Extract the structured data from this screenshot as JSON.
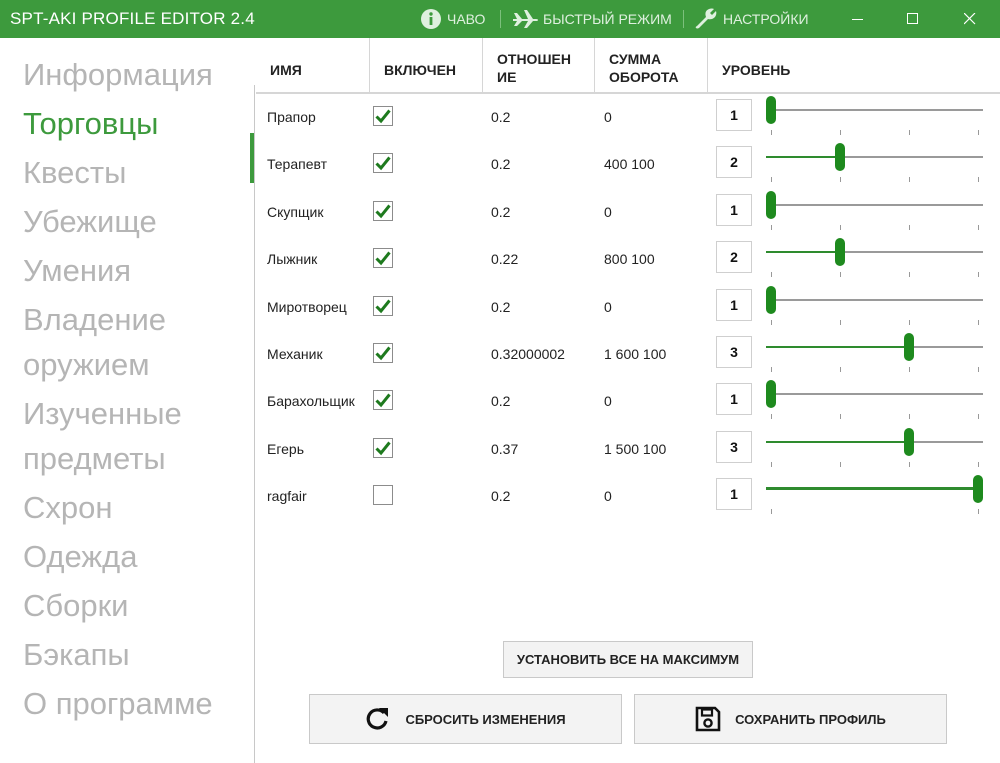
{
  "app": {
    "title": "SPT-AKI PROFILE EDITOR  2.4"
  },
  "titlebar": {
    "faq": "ЧАВО",
    "fast_mode": "БЫСТРЫЙ РЕЖИМ",
    "settings": "НАСТРОЙКИ"
  },
  "sidebar": {
    "items": [
      {
        "label": "Информация"
      },
      {
        "label": "Торговцы"
      },
      {
        "label": "Квесты"
      },
      {
        "label": "Убежище"
      },
      {
        "label": "Умения"
      },
      {
        "label": "Владение\nоружием"
      },
      {
        "label": "Изученные\nпредметы"
      },
      {
        "label": "Схрон"
      },
      {
        "label": "Одежда"
      },
      {
        "label": "Сборки"
      },
      {
        "label": "Бэкапы"
      },
      {
        "label": "О программе"
      }
    ],
    "active": "Торговцы"
  },
  "table": {
    "columns": [
      "ИМЯ",
      "ВКЛЮЧЕН",
      "ОТНОШЕН\nИЕ",
      "СУММА\nОБОРОТА",
      "УРОВЕНЬ"
    ],
    "rows": [
      {
        "name": "Прапор",
        "enabled": true,
        "standing": "0.2",
        "sales": "0",
        "level": "1",
        "level_max": 4
      },
      {
        "name": "Терапевт",
        "enabled": true,
        "standing": "0.2",
        "sales": "400 100",
        "level": "2",
        "level_max": 4
      },
      {
        "name": "Скупщик",
        "enabled": true,
        "standing": "0.2",
        "sales": "0",
        "level": "1",
        "level_max": 4
      },
      {
        "name": "Лыжник",
        "enabled": true,
        "standing": "0.22",
        "sales": "800 100",
        "level": "2",
        "level_max": 4
      },
      {
        "name": "Миротворец",
        "enabled": true,
        "standing": "0.2",
        "sales": "0",
        "level": "1",
        "level_max": 4
      },
      {
        "name": "Механик",
        "enabled": true,
        "standing": "0.32000002",
        "sales": "1 600 100",
        "level": "3",
        "level_max": 4
      },
      {
        "name": "Барахольщик",
        "enabled": true,
        "standing": "0.2",
        "sales": "0",
        "level": "1",
        "level_max": 4
      },
      {
        "name": "Егерь",
        "enabled": true,
        "standing": "0.37",
        "sales": "1 500 100",
        "level": "3",
        "level_max": 4
      },
      {
        "name": "ragfair",
        "enabled": false,
        "standing": "0.2",
        "sales": "0",
        "level": "1",
        "level_max": 1
      }
    ]
  },
  "buttons": {
    "set_max": "УСТАНОВИТЬ ВСЕ НА МАКСИМУМ",
    "reset": "СБРОСИТЬ ИЗМЕНЕНИЯ",
    "save": "СОХРАНИТЬ ПРОФИЛЬ"
  },
  "colors": {
    "accent": "#3d9a3d",
    "checkmark": "#1e7a1e",
    "inactive_nav": "#b5b5b5"
  }
}
